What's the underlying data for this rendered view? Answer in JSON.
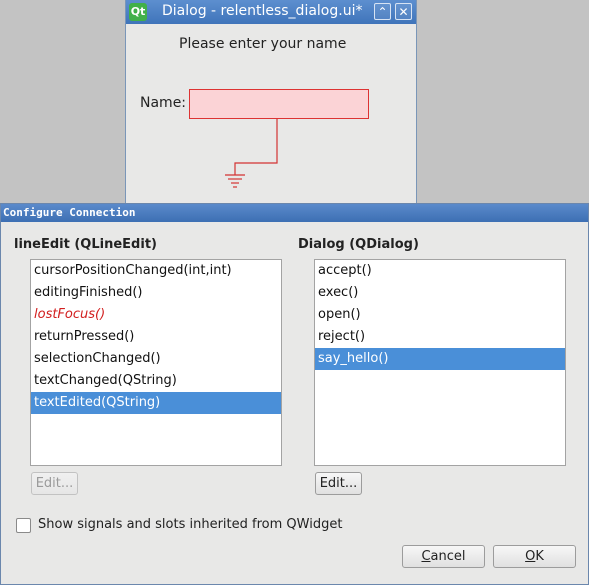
{
  "background_window": {
    "title": "Dialog - relentless_dialog.ui*",
    "logo_text": "Qt",
    "minimize_glyph": "⌃",
    "close_glyph": "✕",
    "prompt": "Please enter your name",
    "name_label": "Name:",
    "accent_color": "#d33333"
  },
  "dialog": {
    "title": "Configure Connection",
    "left": {
      "header": "lineEdit (QLineEdit)",
      "items": [
        {
          "label": "cursorPositionChanged(int,int)"
        },
        {
          "label": "editingFinished()"
        },
        {
          "label": "lostFocus()"
        },
        {
          "label": "returnPressed()"
        },
        {
          "label": "selectionChanged()"
        },
        {
          "label": "textChanged(QString)"
        },
        {
          "label": "textEdited(QString)"
        }
      ],
      "selected_index": 6,
      "highlight_index": 2,
      "edit_button": "Edit...",
      "edit_enabled": false
    },
    "right": {
      "header": "Dialog (QDialog)",
      "items": [
        {
          "label": "accept()"
        },
        {
          "label": "exec()"
        },
        {
          "label": "open()"
        },
        {
          "label": "reject()"
        },
        {
          "label": "say_hello()"
        }
      ],
      "selected_index": 4,
      "edit_button": "Edit...",
      "edit_enabled": true
    },
    "inherit_checkbox_label": "Show signals and slots inherited from QWidget",
    "inherit_checked": false,
    "cancel_label": "Cancel",
    "ok_label": "OK",
    "selection_color": "#4a8fd8"
  }
}
